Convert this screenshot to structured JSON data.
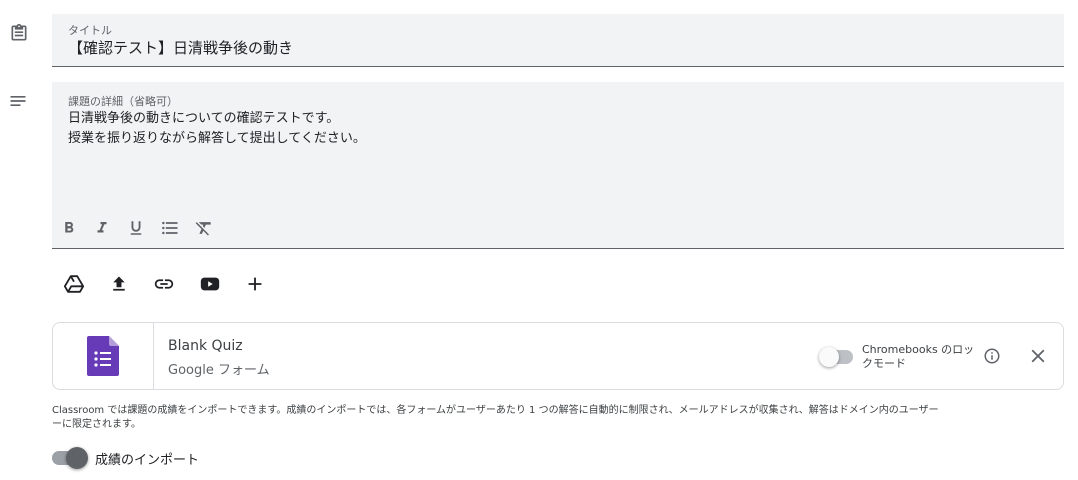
{
  "title_field": {
    "label": "タイトル",
    "value": "【確認テスト】日清戦争後の動き"
  },
  "description_field": {
    "label": "課題の詳細（省略可）",
    "lines": [
      "日清戦争後の動きについての確認テストです。",
      "授業を振り返りながら解答して提出してください。"
    ]
  },
  "format_toolbar": {
    "icons": [
      "bold-icon",
      "italic-icon",
      "underline-icon",
      "bulleted-list-icon",
      "clear-formatting-icon"
    ]
  },
  "attach_toolbar": {
    "icons": [
      "google-drive-icon",
      "upload-icon",
      "link-icon",
      "youtube-icon",
      "add-icon"
    ]
  },
  "attachment": {
    "title": "Blank Quiz",
    "subtitle": "Google フォーム",
    "lock_mode_label_line1": "Chromebooks のロッ",
    "lock_mode_label_line2": "クモード",
    "lock_mode_enabled": false,
    "forms_icon_color": "#673ab7"
  },
  "import_info": {
    "line1": "Classroom では課題の成績をインポートできます。成績のインポートでは、各フォームがユーザーあたり 1 つの解答に自動的に制限され、メールアドレスが収集され、解答はドメイン内のユーザー",
    "line2": "ーに限定されます。"
  },
  "grade_import": {
    "label": "成績のインポート",
    "enabled": false
  }
}
